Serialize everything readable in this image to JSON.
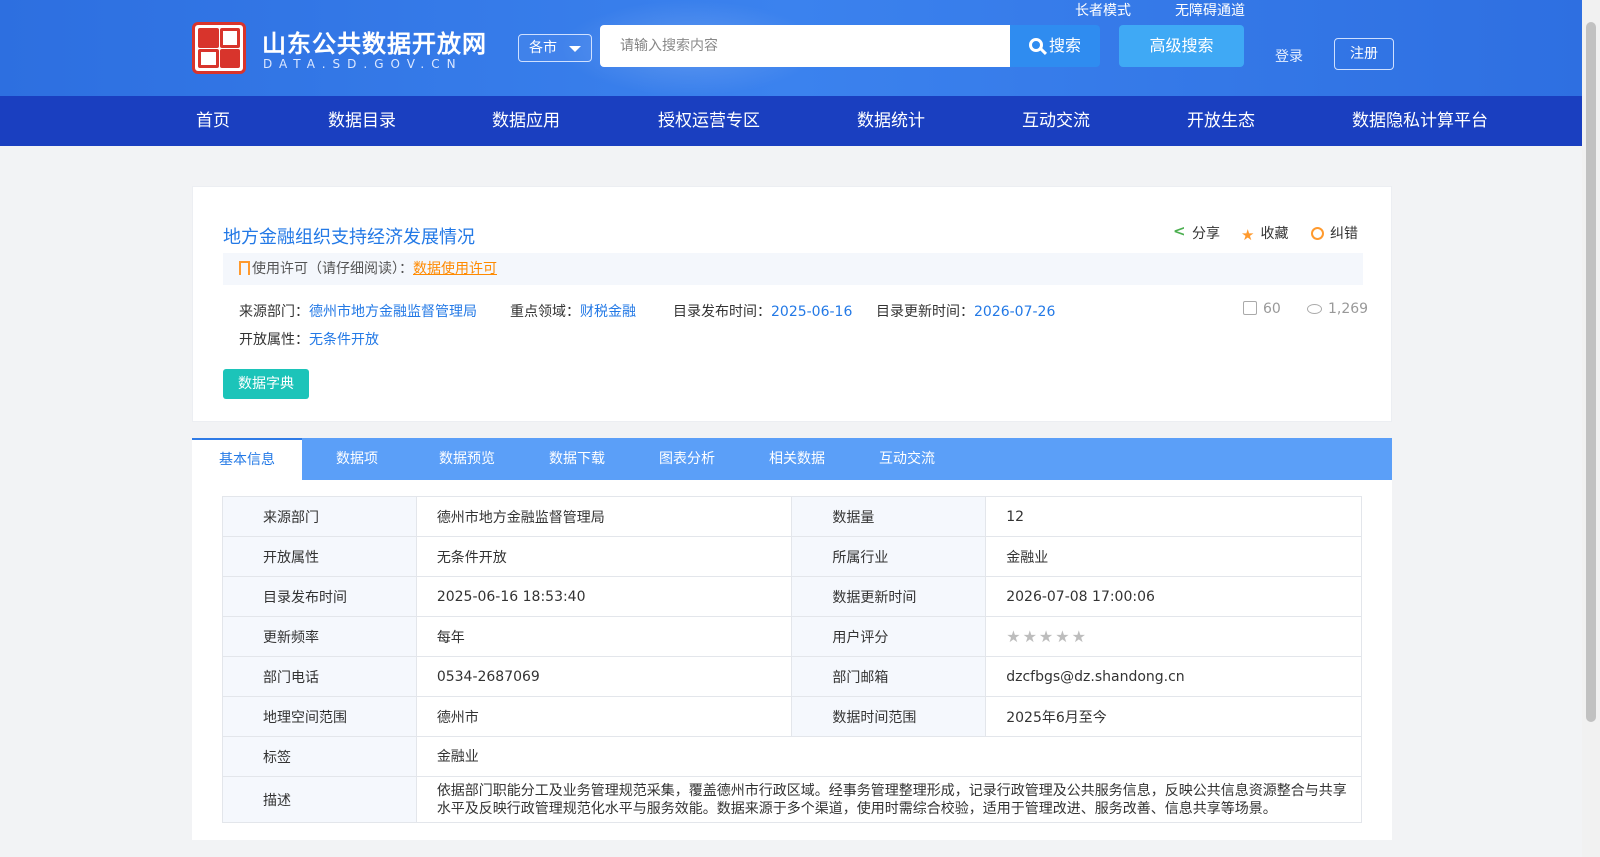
{
  "header": {
    "site_title": "山东公共数据开放网",
    "site_domain": "DATA.SD.GOV.CN",
    "city_select": "各市",
    "search_placeholder": "请输入搜索内容",
    "search_button": "搜索",
    "advanced_search": "高级搜索",
    "elder_mode": "长者模式",
    "accessibility": "无障碍通道",
    "login": "登录",
    "register": "注册"
  },
  "nav": [
    "首页",
    "数据目录",
    "数据应用",
    "授权运营专区",
    "数据统计",
    "互动交流",
    "开放生态",
    "数据隐私计算平台"
  ],
  "dataset": {
    "title": "地方金融组织支持经济发展情况",
    "actions": {
      "share": "分享",
      "favorite": "收藏",
      "report": "纠错"
    },
    "license_label": "使用许可（请仔细阅读）：",
    "license_link": "数据使用许可",
    "source_label": "来源部门：",
    "source_value": "德州市地方金融监督管理局",
    "domain_label": "重点领域：",
    "domain_value": "财税金融",
    "publish_label": "目录发布时间：",
    "publish_value": "2025-06-16",
    "update_label": "目录更新时间：",
    "update_value": "2026-07-26",
    "open_label": "开放属性：",
    "open_value": "无条件开放",
    "downloads": "60",
    "views": "1,269",
    "dict_button": "数据字典"
  },
  "tabs": [
    "基本信息",
    "数据项",
    "数据预览",
    "数据下载",
    "图表分析",
    "相关数据",
    "互动交流"
  ],
  "info": {
    "rows": [
      {
        "k1": "来源部门",
        "v1": "德州市地方金融监督管理局",
        "k2": "数据量",
        "v2": "12"
      },
      {
        "k1": "开放属性",
        "v1": "无条件开放",
        "k2": "所属行业",
        "v2": "金融业"
      },
      {
        "k1": "目录发布时间",
        "v1": "2025-06-16 18:53:40",
        "k2": "数据更新时间",
        "v2": "2026-07-08 17:00:06"
      },
      {
        "k1": "更新频率",
        "v1": "每年",
        "k2": "用户评分",
        "v2": ""
      },
      {
        "k1": "部门电话",
        "v1": "0534-2687069",
        "k2": "部门邮箱",
        "v2": "dzcfbgs@dz.shandong.cn"
      },
      {
        "k1": "地理空间范围",
        "v1": "德州市",
        "k2": "数据时间范围",
        "v2": "2025年6月至今"
      }
    ],
    "tags_label": "标签",
    "tags_value": "金融业",
    "desc_label": "描述",
    "desc_value": "依据部门职能分工及业务管理规范采集，覆盖德州市行政区域。经事务管理整理形成，记录行政管理及公共服务信息，反映公共信息资源整合与共享水平及反映行政管理规范化水平与服务效能。数据来源于多个渠道，使用时需综合校验，适用于管理改进、服务改善、信息共享等场景。",
    "rating": 0
  }
}
